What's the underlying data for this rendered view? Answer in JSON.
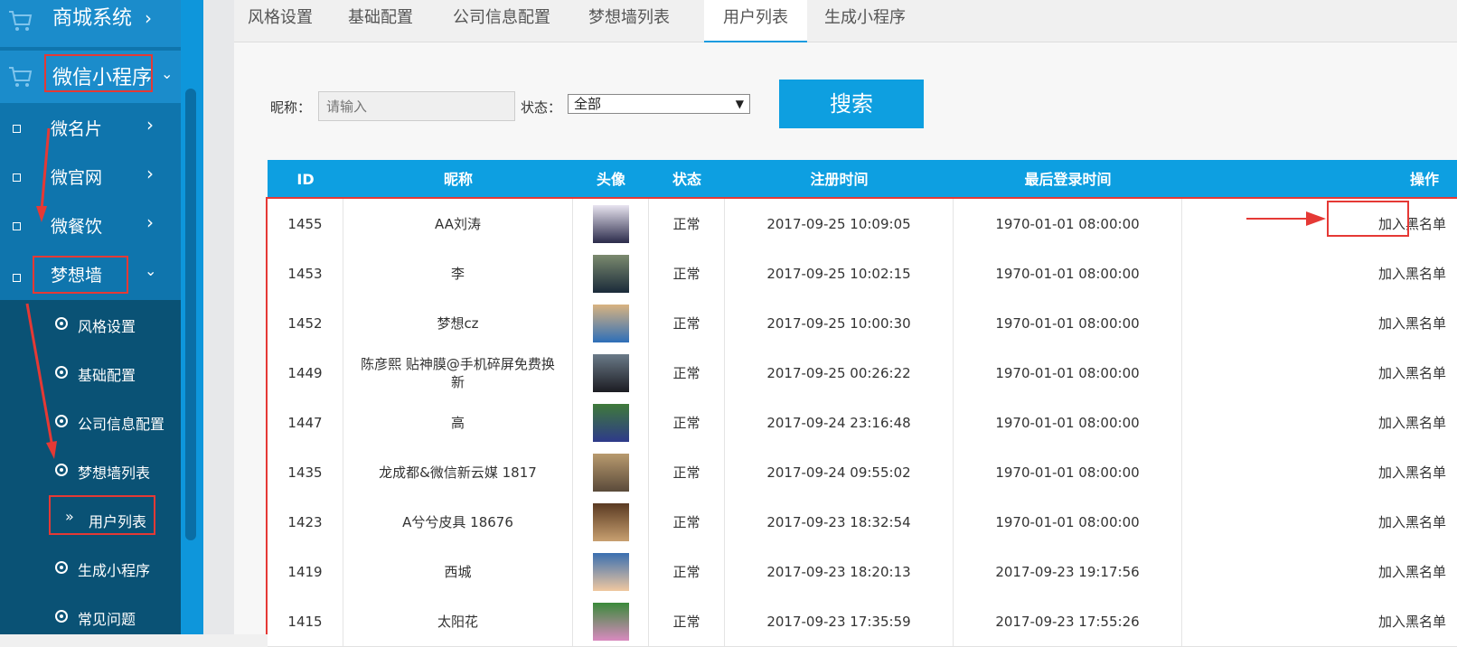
{
  "sidebar": {
    "shop": "商城系统",
    "wechat_mini": "微信小程序",
    "sub": [
      "微名片",
      "微官网",
      "微餐饮",
      "梦想墙"
    ],
    "leaves": [
      "风格设置",
      "基础配置",
      "公司信息配置",
      "梦想墙列表",
      "用户列表",
      "生成小程序",
      "常见问题"
    ]
  },
  "tabs": [
    "风格设置",
    "基础配置",
    "公司信息配置",
    "梦想墙列表",
    "用户列表",
    "生成小程序"
  ],
  "filter": {
    "nick_label": "昵称：",
    "nick_placeholder": "请输入",
    "status_label": "状态：",
    "status_value": "全部",
    "search_label": "搜索"
  },
  "table": {
    "headers": [
      "ID",
      "昵称",
      "头像",
      "状态",
      "注册时间",
      "最后登录时间",
      "操作"
    ],
    "rows": [
      {
        "id": "1455",
        "nick": "AA刘涛",
        "status": "正常",
        "reg": "2017-09-25 10:09:05",
        "last": "1970-01-01 08:00:00",
        "action": "加入黑名单"
      },
      {
        "id": "1453",
        "nick": "李",
        "status": "正常",
        "reg": "2017-09-25 10:02:15",
        "last": "1970-01-01 08:00:00",
        "action": "加入黑名单"
      },
      {
        "id": "1452",
        "nick": "梦想cz",
        "status": "正常",
        "reg": "2017-09-25 10:00:30",
        "last": "1970-01-01 08:00:00",
        "action": "加入黑名单"
      },
      {
        "id": "1449",
        "nick": "陈彦熙 贴神膜@手机碎屏免费换新",
        "status": "正常",
        "reg": "2017-09-25 00:26:22",
        "last": "1970-01-01 08:00:00",
        "action": "加入黑名单"
      },
      {
        "id": "1447",
        "nick": "高",
        "status": "正常",
        "reg": "2017-09-24 23:16:48",
        "last": "1970-01-01 08:00:00",
        "action": "加入黑名单"
      },
      {
        "id": "1435",
        "nick": "龙成都&微信新云媒 1817",
        "status": "正常",
        "reg": "2017-09-24 09:55:02",
        "last": "1970-01-01 08:00:00",
        "action": "加入黑名单"
      },
      {
        "id": "1423",
        "nick": "A兮兮皮具 18676",
        "status": "正常",
        "reg": "2017-09-23 18:32:54",
        "last": "1970-01-01 08:00:00",
        "action": "加入黑名单"
      },
      {
        "id": "1419",
        "nick": "西城",
        "status": "正常",
        "reg": "2017-09-23 18:20:13",
        "last": "2017-09-23 19:17:56",
        "action": "加入黑名单"
      },
      {
        "id": "1415",
        "nick": "太阳花",
        "status": "正常",
        "reg": "2017-09-23 17:35:59",
        "last": "2017-09-23 17:55:26",
        "action": "加入黑名单"
      }
    ]
  },
  "colors": {
    "sidebar": "#0f75ad",
    "sidebar_leaf_bg": "#0a5275",
    "accent": "#0e9fe0",
    "annotation": "#e53935"
  }
}
